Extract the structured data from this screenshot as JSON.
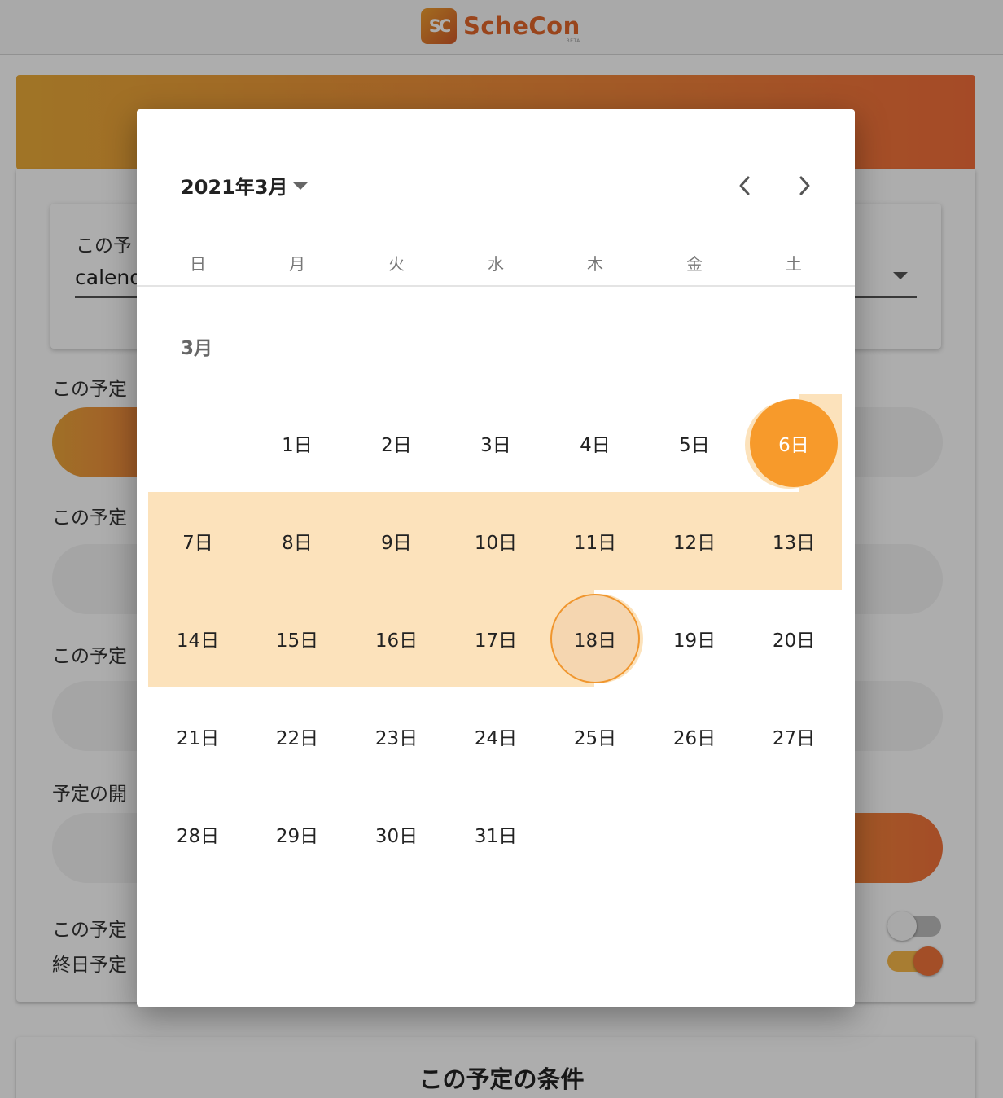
{
  "app": {
    "logo_mark": "SC",
    "name": "ScheCon",
    "beta": "BETA"
  },
  "background": {
    "calendar_field_label": "この予",
    "calendar_field_value": "calend",
    "field1_label": "この予定",
    "field2_label": "この予定",
    "field3_label": "この予定",
    "field4_label": "予定の開",
    "toggle1_label": "この予定",
    "toggle2_label": "終日予定",
    "conditions_title": "この予定の条件"
  },
  "picker": {
    "month_title": "2021年3月",
    "month_label": "3月",
    "prev_icon": "chevron-left-icon",
    "next_icon": "chevron-right-icon",
    "weekdays": [
      "日",
      "月",
      "火",
      "水",
      "木",
      "金",
      "土"
    ],
    "days": [
      "1日",
      "2日",
      "3日",
      "4日",
      "5日",
      "6日",
      "7日",
      "8日",
      "9日",
      "10日",
      "11日",
      "12日",
      "13日",
      "14日",
      "15日",
      "16日",
      "17日",
      "18日",
      "19日",
      "20日",
      "21日",
      "22日",
      "23日",
      "24日",
      "25日",
      "26日",
      "27日",
      "28日",
      "29日",
      "30日",
      "31日"
    ],
    "first_weekday_index": 1,
    "range_start": "6日",
    "range_end": "18日",
    "colors": {
      "accent": "#f79a2b",
      "range_fill": "#fce2bb",
      "end_fill": "#f5d6b0"
    }
  }
}
